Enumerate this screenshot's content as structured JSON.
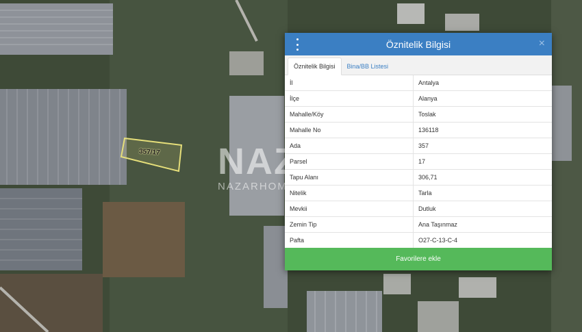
{
  "map": {
    "parcel_label": "357/17",
    "watermark": {
      "logo": "NAZAR",
      "sub": "NAZARHOME"
    }
  },
  "dialog": {
    "title": "Öznitelik Bilgisi",
    "tabs": [
      {
        "label": "Öznitelik Bilgisi",
        "active": true
      },
      {
        "label": "Bina/BB Listesi",
        "active": false
      }
    ],
    "rows": [
      {
        "key": "İl",
        "value": "Antalya"
      },
      {
        "key": "İlçe",
        "value": "Alanya"
      },
      {
        "key": "Mahalle/Köy",
        "value": "Toslak"
      },
      {
        "key": "Mahalle No",
        "value": "136118"
      },
      {
        "key": "Ada",
        "value": "357"
      },
      {
        "key": "Parsel",
        "value": "17"
      },
      {
        "key": "Tapu Alanı",
        "value": "306,71"
      },
      {
        "key": "Nitelik",
        "value": "Tarla"
      },
      {
        "key": "Mevkii",
        "value": "Dutluk"
      },
      {
        "key": "Zemin Tip",
        "value": "Ana Taşınmaz"
      },
      {
        "key": "Pafta",
        "value": "O27-C-13-C-4"
      }
    ],
    "favorite_button": "Favorilere ekle",
    "close_symbol": "×"
  },
  "colors": {
    "header": "#3b7fc3",
    "favorite": "#55b95a",
    "parcel_outline": "#e6df7a"
  }
}
